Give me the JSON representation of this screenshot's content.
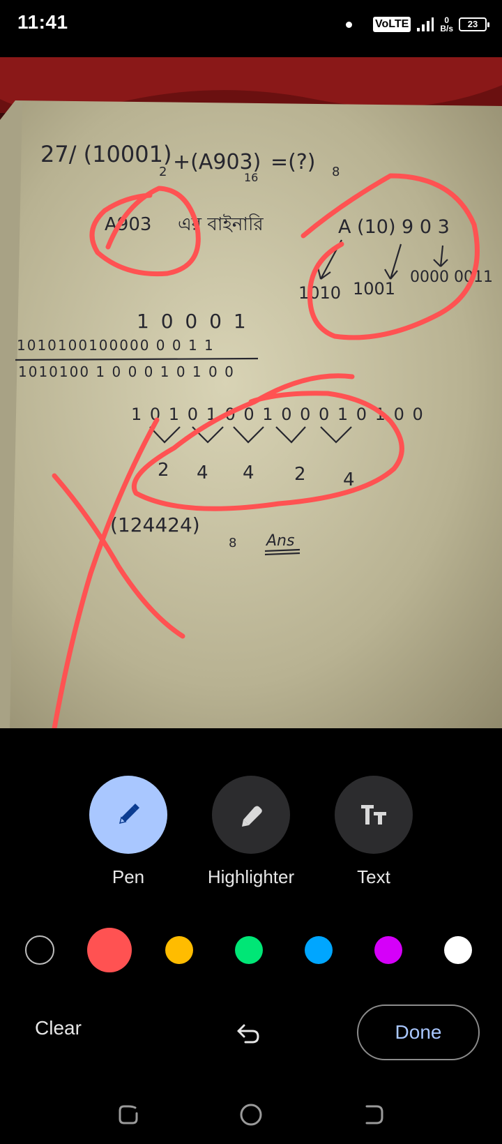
{
  "status_bar": {
    "time": "11:41",
    "network": "VoLTE",
    "speed_value": "0",
    "speed_unit": "B/s",
    "battery": "23"
  },
  "photo": {
    "description_icon": "notebook-photo-with-handwritten-binary-octal-conversion"
  },
  "tools": [
    {
      "label": "Pen",
      "icon": "pen-icon",
      "active": true
    },
    {
      "label": "Highlighter",
      "icon": "highlighter-icon",
      "active": false
    },
    {
      "label": "Text",
      "icon": "text-icon",
      "active": false
    }
  ],
  "palette": {
    "colors": [
      "#000000",
      "#ff5252",
      "#ffbc00",
      "#00e676",
      "#00a6ff",
      "#d500f9",
      "#ffffff"
    ],
    "selected": "#ff5252"
  },
  "actions": {
    "clear_label": "Clear",
    "done_label": "Done"
  },
  "handwriting": {
    "problem": "27/ (10001)",
    "problem_base": "2",
    "plus_term": "+(A903)",
    "plus_base": "16",
    "equals": "=(?)",
    "equals_base": "8",
    "line2_left": "A903",
    "line2_bengali": "এর বাইনারি",
    "line2_right": "A (10) 9 0 3",
    "groups": [
      "1010",
      "1001",
      "0000 0011"
    ],
    "sum_top": "1 0 0 0 1",
    "sum_mid": "1010100100000 0 0 1 1",
    "sum_bottom": "1010100 1 0 0 0 1 0 1 0 0",
    "grouped": "1 0 1 0 1 0 0 1 0 0 0 1 0 1 0 0",
    "octal_digits": [
      "2",
      "4",
      "4",
      "2",
      "4"
    ],
    "answer": "(124424)",
    "answer_base": "8",
    "ans_label": "Ans"
  }
}
